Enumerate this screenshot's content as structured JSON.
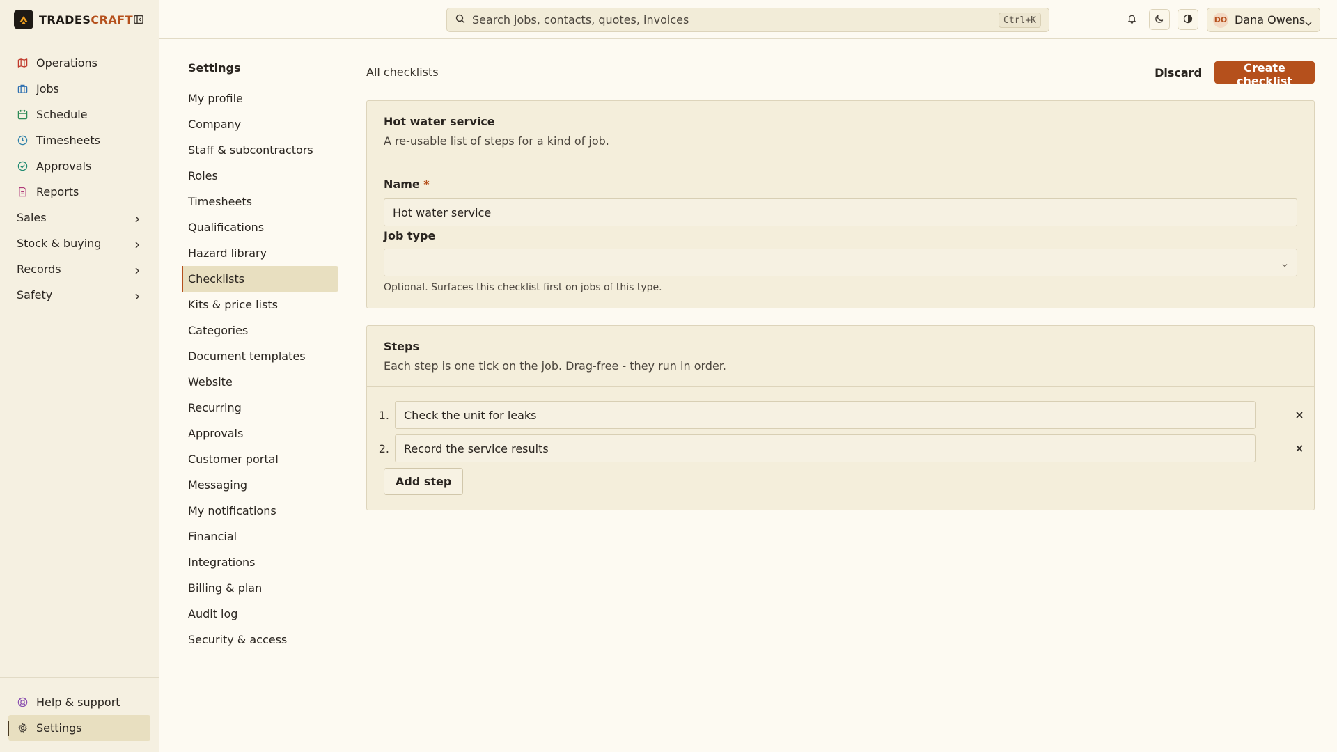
{
  "brand": {
    "name_part1": "TRADES",
    "name_part2": "CRAFT"
  },
  "sidebar": {
    "items": [
      {
        "label": "Operations",
        "icon": "map-icon",
        "color": "#c0392b"
      },
      {
        "label": "Jobs",
        "icon": "briefcase-icon",
        "color": "#2e6fb0"
      },
      {
        "label": "Schedule",
        "icon": "calendar-icon",
        "color": "#2e8b57"
      },
      {
        "label": "Timesheets",
        "icon": "clock-icon",
        "color": "#2b7fa8"
      },
      {
        "label": "Approvals",
        "icon": "check-circle-icon",
        "color": "#1f8a70"
      },
      {
        "label": "Reports",
        "icon": "report-icon",
        "color": "#b03a7a"
      },
      {
        "label": "Sales"
      },
      {
        "label": "Stock & buying"
      },
      {
        "label": "Records"
      },
      {
        "label": "Safety"
      }
    ],
    "bottom": [
      {
        "label": "Help & support",
        "icon": "lifebuoy-icon",
        "color": "#8a4fb0"
      },
      {
        "label": "Settings",
        "icon": "gear-icon",
        "color": "#4c463e"
      }
    ]
  },
  "topbar": {
    "search_placeholder": "Search jobs, contacts, quotes, invoices",
    "shortcut": "Ctrl+K",
    "user_initials": "DO",
    "user_name": "Dana Owens"
  },
  "settings_nav": {
    "title": "Settings",
    "items": [
      "My profile",
      "Company",
      "Staff & subcontractors",
      "Roles",
      "Timesheets",
      "Qualifications",
      "Hazard library",
      "Checklists",
      "Kits & price lists",
      "Categories",
      "Document templates",
      "Website",
      "Recurring",
      "Approvals",
      "Customer portal",
      "Messaging",
      "My notifications",
      "Financial",
      "Integrations",
      "Billing & plan",
      "Audit log",
      "Security & access"
    ],
    "active_index": 7
  },
  "main": {
    "breadcrumb": "All checklists",
    "discard_label": "Discard",
    "create_label": "Create checklist",
    "details_card": {
      "title": "Hot water service",
      "subtitle": "A re-usable list of steps for a kind of job.",
      "name_label": "Name",
      "required_mark": "*",
      "name_value": "Hot water service",
      "job_type_label": "Job type",
      "job_type_value": "",
      "job_type_hint": "Optional. Surfaces this checklist first on jobs of this type."
    },
    "steps_card": {
      "title": "Steps",
      "subtitle": "Each step is one tick on the job. Drag-free - they run in order.",
      "steps": [
        {
          "num": "1.",
          "value": "Check the unit for leaks"
        },
        {
          "num": "2.",
          "value": "Record the service results"
        }
      ],
      "add_label": "Add step"
    }
  },
  "colors": {
    "accent": "#b5501c",
    "background": "#fdfaf2",
    "sidebar": "#f5f0e1",
    "card": "#f4eedb"
  }
}
